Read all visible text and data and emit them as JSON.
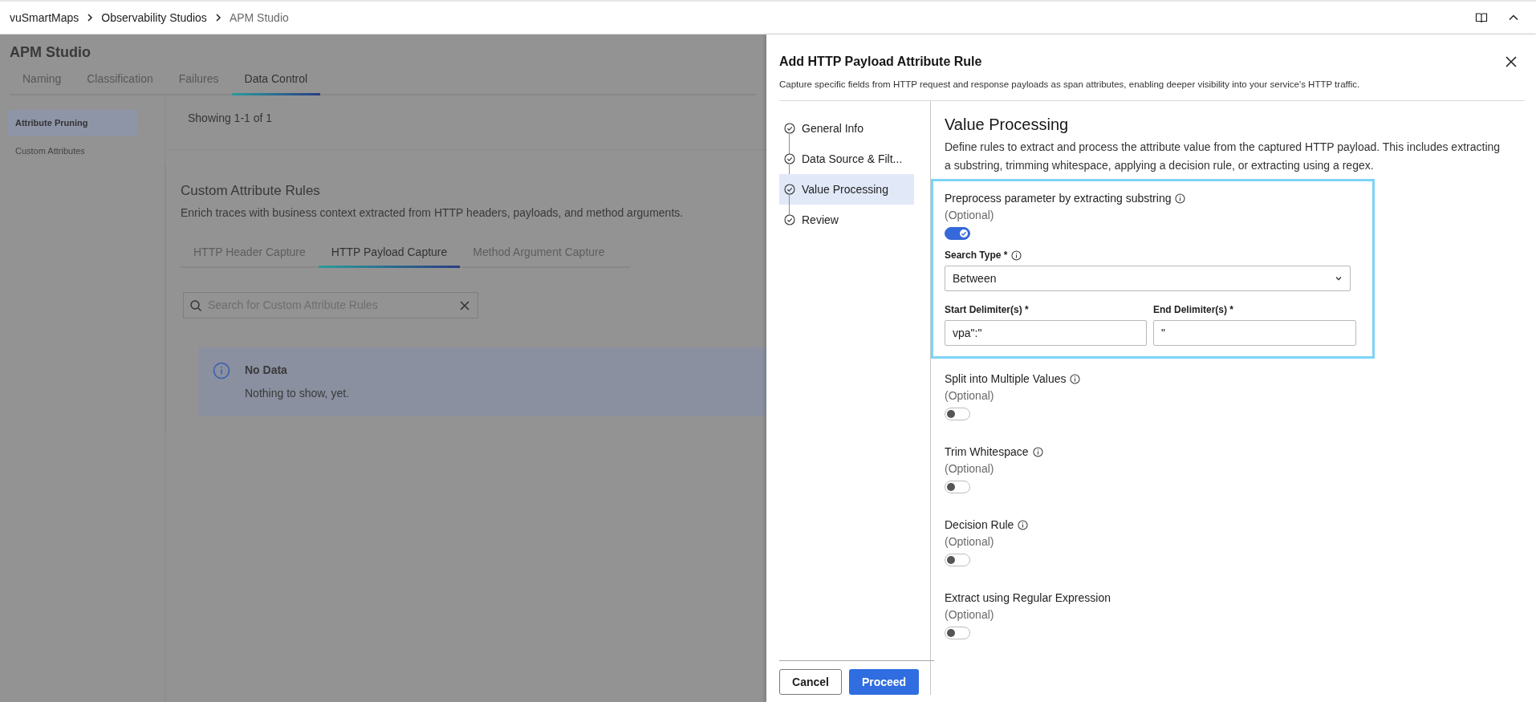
{
  "breadcrumb": [
    {
      "label": "vuSmartMaps",
      "current": false
    },
    {
      "label": "Observability Studios",
      "current": false
    },
    {
      "label": "APM Studio",
      "current": true
    }
  ],
  "page": {
    "title": "APM Studio",
    "tabs": [
      {
        "label": "Naming",
        "selected": false
      },
      {
        "label": "Classification",
        "selected": false
      },
      {
        "label": "Failures",
        "selected": false
      },
      {
        "label": "Data Control",
        "selected": true
      }
    ],
    "sidebar": [
      {
        "label": "Attribute Pruning",
        "selected": true
      },
      {
        "label": "Custom Attributes",
        "selected": false
      }
    ],
    "results_summary": "Showing 1-1 of 1",
    "section": {
      "title": "Custom Attribute Rules",
      "description": "Enrich traces with business context extracted from HTTP headers, payloads, and method arguments.",
      "tabs": [
        {
          "label": "HTTP Header Capture",
          "selected": false
        },
        {
          "label": "HTTP Payload Capture",
          "selected": true
        },
        {
          "label": "Method Argument Capture",
          "selected": false
        }
      ],
      "search": {
        "placeholder": "Search for Custom Attribute Rules"
      },
      "alert": {
        "title": "No Data",
        "message": "Nothing to show, yet."
      }
    }
  },
  "drawer": {
    "title": "Add HTTP Payload Attribute Rule",
    "subtitle": "Capture specific fields from HTTP request and response payloads as span attributes, enabling deeper visibility into your service's HTTP traffic.",
    "steps": [
      {
        "label": "General Info",
        "selected": false
      },
      {
        "label": "Data Source & Filt...",
        "selected": false
      },
      {
        "label": "Value Processing",
        "selected": true
      },
      {
        "label": "Review",
        "selected": false
      }
    ],
    "heading": "Value Processing",
    "description": "Define rules to extract and process the attribute value from the captured HTTP payload. This includes extracting a substring, trimming whitespace, applying a decision rule, or extracting using a regex.",
    "options": [
      {
        "label": "Preprocess parameter by extracting substring",
        "info": true,
        "hint": "(Optional)",
        "on": true,
        "highlighted": true,
        "search_type": {
          "label": "Search Type *",
          "info": true,
          "value": "Between"
        },
        "delimiters": [
          {
            "label": "Start Delimiter(s) *",
            "value": "vpa\":\""
          },
          {
            "label": "End Delimiter(s) *",
            "value": "\""
          }
        ]
      },
      {
        "label": "Split into Multiple Values",
        "info": true,
        "hint": "(Optional)",
        "on": false,
        "highlighted": false
      },
      {
        "label": "Trim Whitespace",
        "info": true,
        "hint": "(Optional)",
        "on": false,
        "highlighted": false
      },
      {
        "label": "Decision Rule",
        "info": true,
        "hint": "(Optional)",
        "on": false,
        "highlighted": false
      },
      {
        "label": "Extract using Regular Expression",
        "info": false,
        "hint": "(Optional)",
        "on": false,
        "highlighted": false
      }
    ],
    "buttons": [
      {
        "label": "Cancel",
        "kind": "secondary"
      },
      {
        "label": "Proceed",
        "kind": "primary"
      }
    ]
  }
}
